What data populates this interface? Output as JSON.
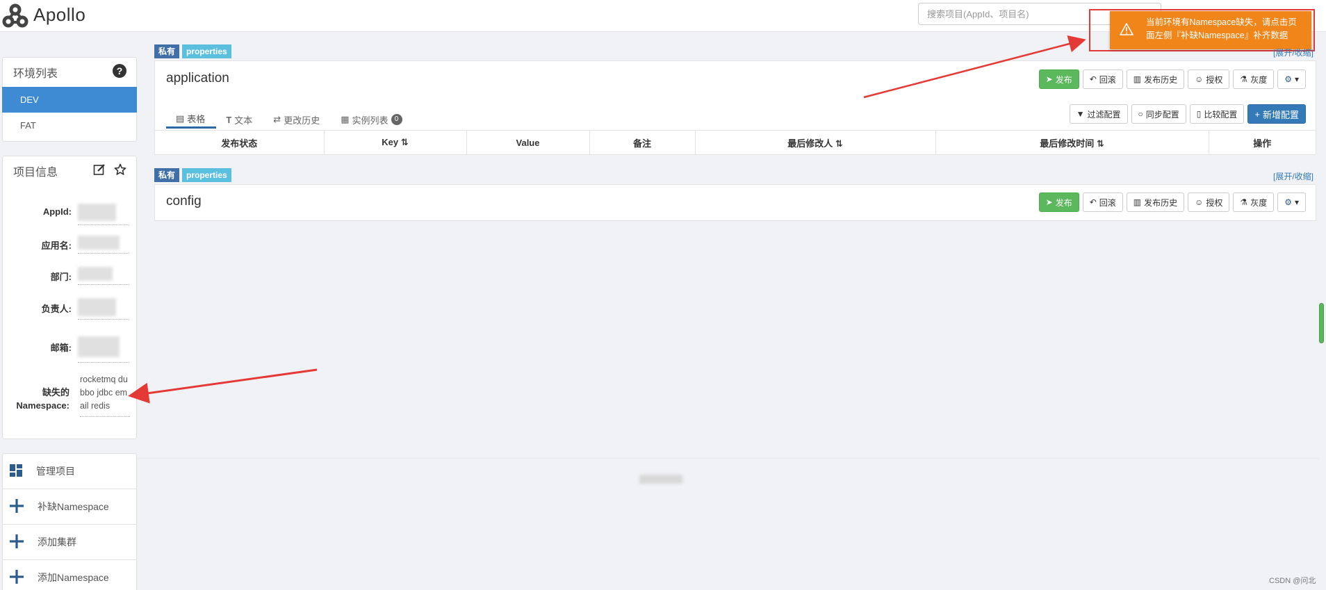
{
  "header": {
    "app_name": "Apollo",
    "search_placeholder": "搜索项目(AppId、项目名)"
  },
  "toast": {
    "message": "当前环境有Namespace缺失，请点击页面左侧『补缺Namespace』补齐数据"
  },
  "env_panel": {
    "title": "环境列表",
    "items": [
      {
        "label": "DEV",
        "active": true
      },
      {
        "label": "FAT",
        "active": false
      }
    ]
  },
  "project_panel": {
    "title": "项目信息",
    "fields": [
      {
        "label": "AppId:"
      },
      {
        "label": "应用名:"
      },
      {
        "label": "部门:"
      },
      {
        "label": "负责人:"
      },
      {
        "label": "邮箱:"
      }
    ],
    "missing_label": "缺失的Namespace:",
    "missing_value": "rocketmq dubbo jdbc email redis"
  },
  "actions": [
    {
      "label": "管理项目",
      "icon": "dashboard-icon"
    },
    {
      "label": "补缺Namespace",
      "icon": "plus-icon"
    },
    {
      "label": "添加集群",
      "icon": "plus-icon"
    },
    {
      "label": "添加Namespace",
      "icon": "plus-icon"
    }
  ],
  "namespaces": [
    {
      "name": "application",
      "tag_private": "私有",
      "tag_format": "properties",
      "toggle": "[展开/收缩]",
      "buttons": {
        "publish": "发布",
        "rollback": "回滚",
        "history": "发布历史",
        "grant": "授权",
        "gray": "灰度"
      },
      "tabs": [
        {
          "label": "表格",
          "active": true
        },
        {
          "label": "文本",
          "active": false
        },
        {
          "label": "更改历史",
          "active": false
        },
        {
          "label": "实例列表",
          "active": false,
          "badge": "0"
        }
      ],
      "tools": {
        "filter": "过滤配置",
        "sync": "同步配置",
        "compare": "比较配置",
        "add": "新增配置"
      },
      "columns": [
        "发布状态",
        "Key",
        "Value",
        "备注",
        "最后修改人",
        "最后修改时间",
        "操作"
      ]
    },
    {
      "name": "config",
      "tag_private": "私有",
      "tag_format": "properties",
      "toggle": "[展开/收缩]",
      "buttons": {
        "publish": "发布",
        "rollback": "回滚",
        "history": "发布历史",
        "grant": "授权",
        "gray": "灰度"
      }
    }
  ],
  "watermark": "CSDN @问北",
  "colors": {
    "primary": "#337ab7",
    "active_env": "#3f8bd3",
    "publish": "#5cb85c",
    "toast": "#f0861a",
    "annotation_red": "#e53935"
  }
}
